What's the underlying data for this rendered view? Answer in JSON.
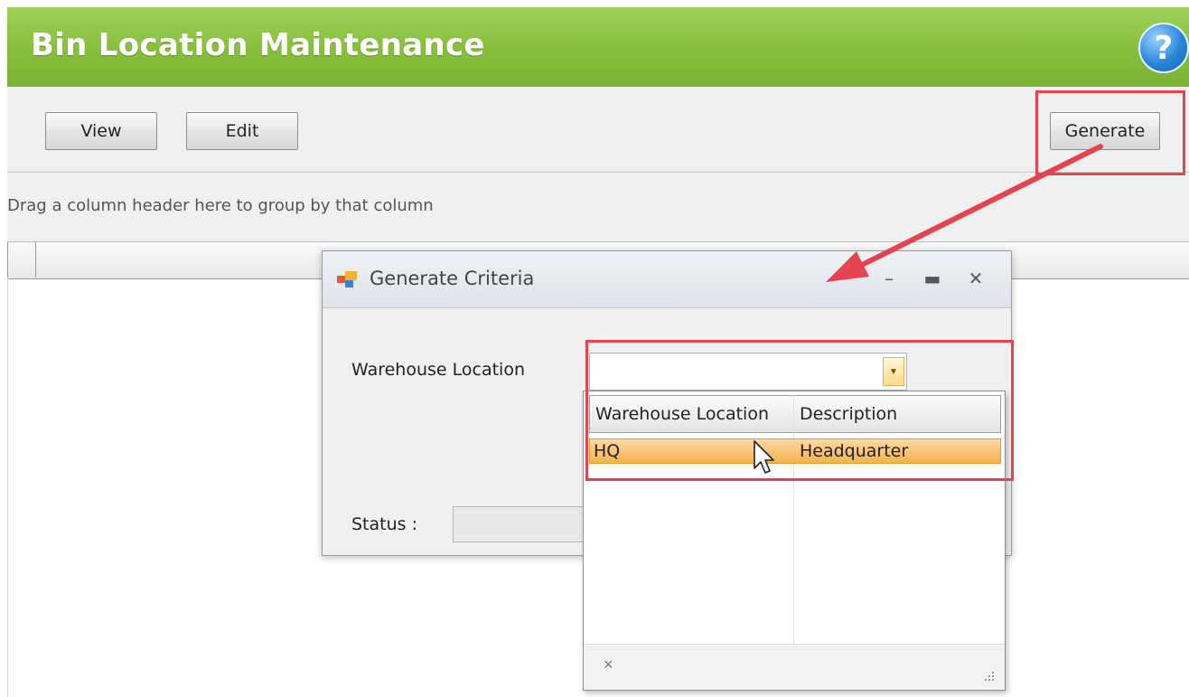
{
  "app": {
    "title": "Bin Location Maintenance",
    "help_icon": "help-question-icon",
    "brand_color": "#86bf3c"
  },
  "toolbar": {
    "view_label": "View",
    "edit_label": "Edit",
    "generate_label": "Generate"
  },
  "grid": {
    "group_hint": "Drag a column header here to group by that column"
  },
  "dialog": {
    "title": "Generate Criteria",
    "warehouse_label": "Warehouse Location",
    "status_label": "Status :",
    "warehouse_value": ""
  },
  "dropdown": {
    "columns": [
      "Warehouse Location",
      "Description"
    ],
    "rows": [
      {
        "location": "HQ",
        "description": "Headquarter"
      }
    ],
    "footer_close": "×",
    "selected_color": "#f6b14e"
  },
  "annotation": {
    "color": "#e5434f"
  }
}
